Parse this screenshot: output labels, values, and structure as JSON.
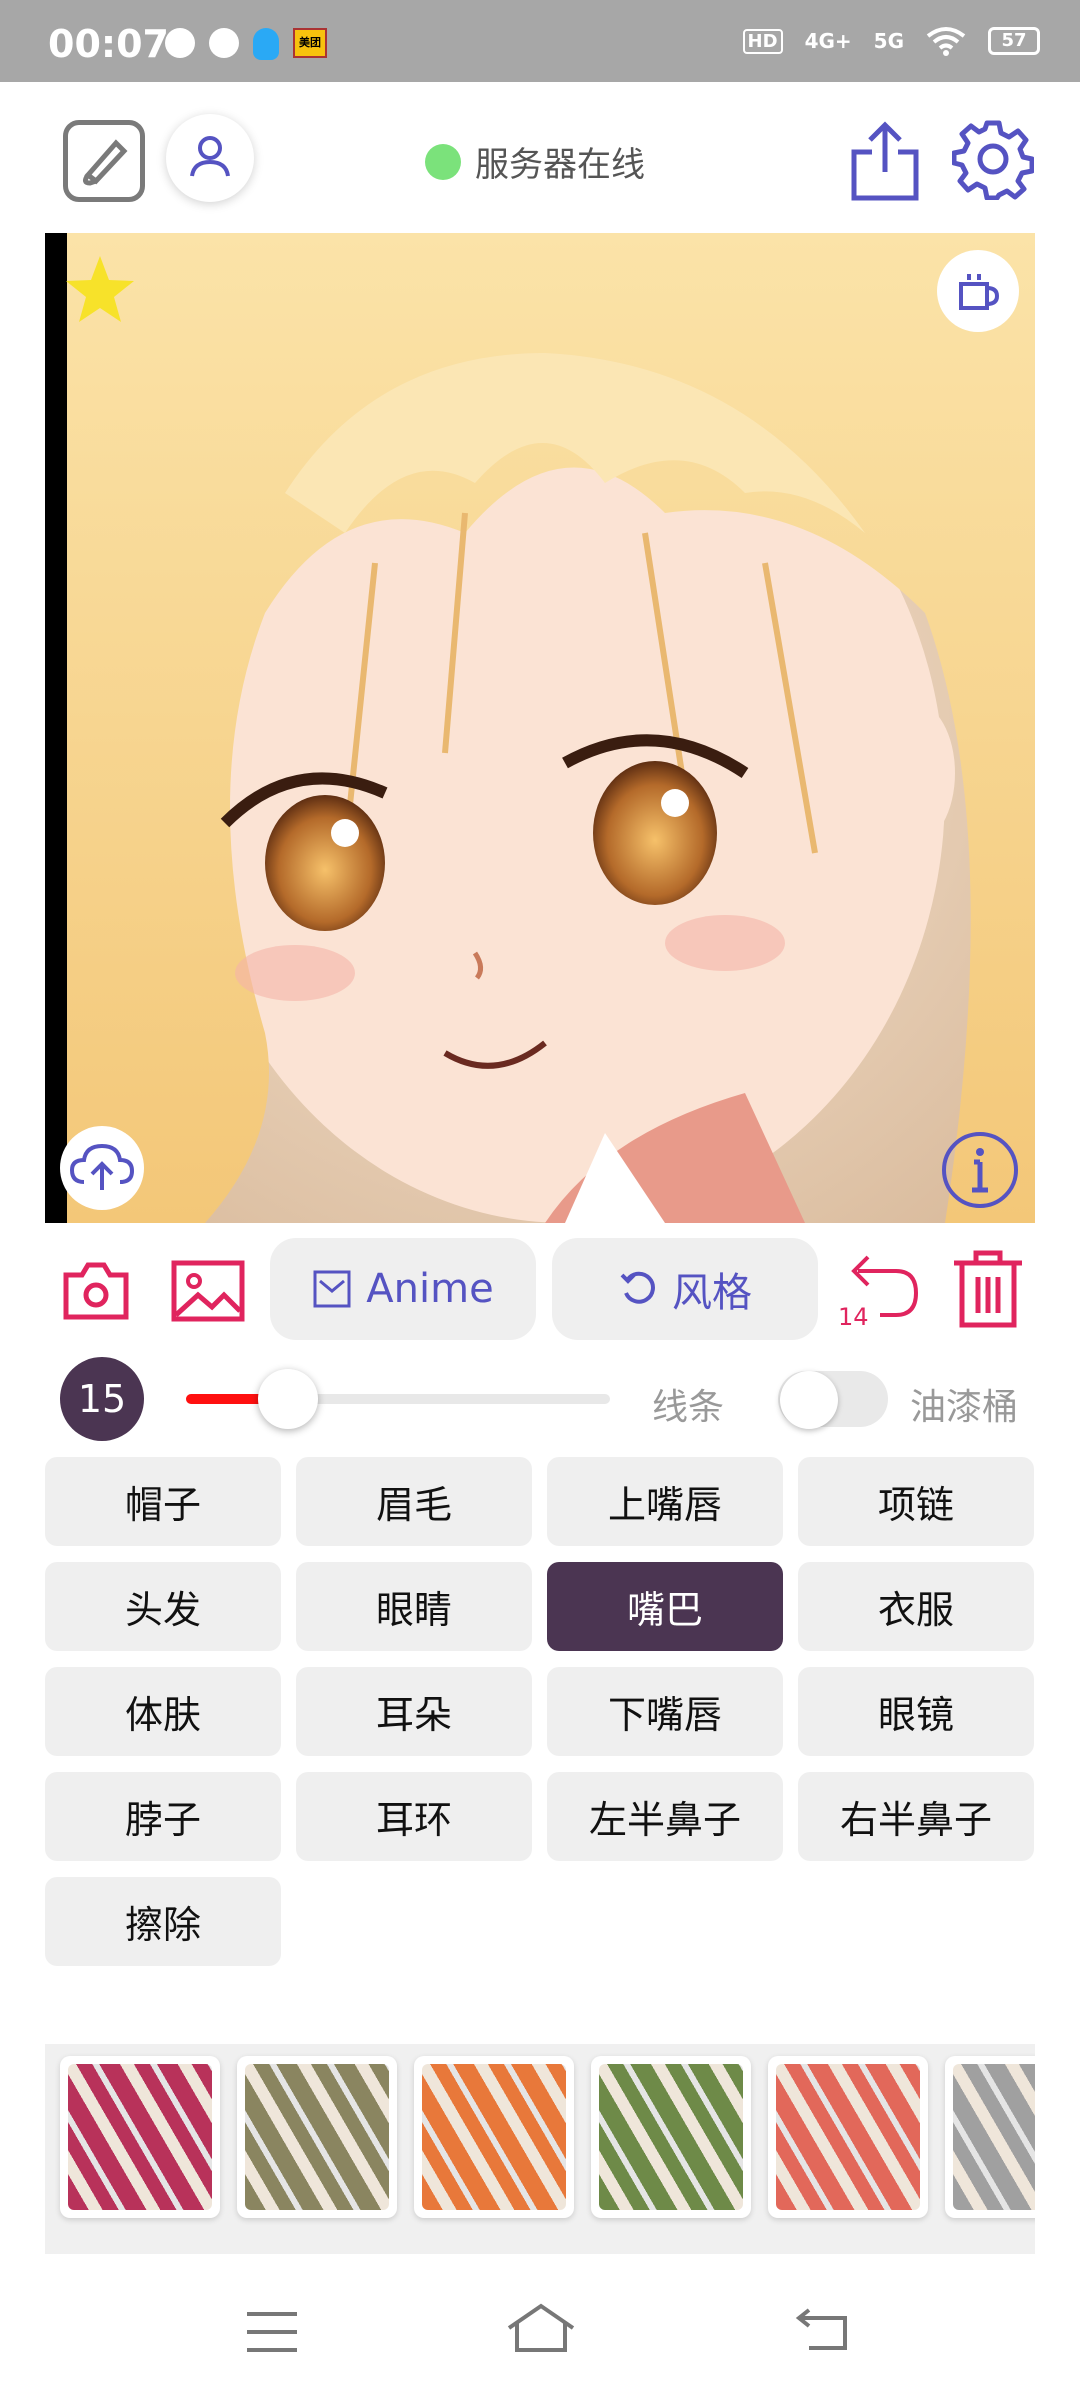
{
  "status_bar": {
    "time": "00:07",
    "network_hd": "HD",
    "network_4g": "4G+",
    "network_5g": "5G",
    "battery": "57"
  },
  "header": {
    "server_status_text": "服务器在线",
    "server_status_color": "#7be27b"
  },
  "toolbar": {
    "model_label": "Anime",
    "style_label": "风格",
    "undo_count": "14"
  },
  "brush": {
    "size": "15",
    "size_fraction": 0.24,
    "line_label": "线条",
    "bucket_label": "油漆桶",
    "bucket_enabled": false
  },
  "parts": [
    {
      "label": "帽子",
      "active": false
    },
    {
      "label": "眉毛",
      "active": false
    },
    {
      "label": "上嘴唇",
      "active": false
    },
    {
      "label": "项链",
      "active": false
    },
    {
      "label": "头发",
      "active": false
    },
    {
      "label": "眼睛",
      "active": false
    },
    {
      "label": "嘴巴",
      "active": true
    },
    {
      "label": "衣服",
      "active": false
    },
    {
      "label": "体肤",
      "active": false
    },
    {
      "label": "耳朵",
      "active": false
    },
    {
      "label": "下嘴唇",
      "active": false
    },
    {
      "label": "眼镜",
      "active": false
    },
    {
      "label": "脖子",
      "active": false
    },
    {
      "label": "耳环",
      "active": false
    },
    {
      "label": "左半鼻子",
      "active": false
    },
    {
      "label": "右半鼻子",
      "active": false
    },
    {
      "label": "擦除",
      "active": false
    }
  ],
  "textures": [
    {
      "name": "texture-crimson",
      "color": "#b8325a"
    },
    {
      "name": "texture-khaki",
      "color": "#8a8560"
    },
    {
      "name": "texture-orange",
      "color": "#e8783a"
    },
    {
      "name": "texture-green",
      "color": "#6e8a48"
    },
    {
      "name": "texture-salmon",
      "color": "#e2685a"
    },
    {
      "name": "texture-gray",
      "color": "#a0a0a0"
    }
  ],
  "colors": {
    "accent": "#5553c2",
    "danger": "#e0245e",
    "active_part": "#4b3552",
    "slider_fill": "#ff1010"
  }
}
